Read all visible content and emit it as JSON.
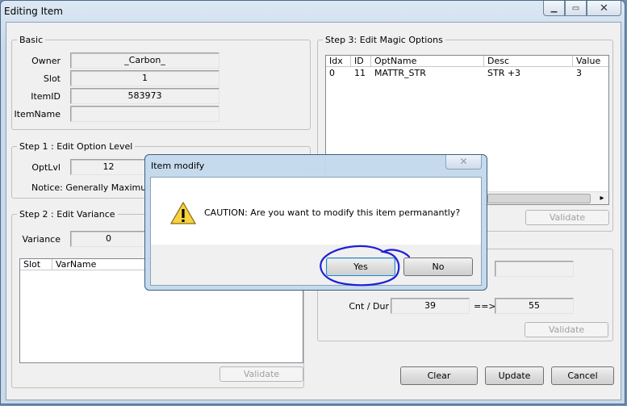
{
  "window": {
    "title": "Editing Item",
    "minimize_glyph": "▁",
    "maximize_glyph": "▭",
    "close_glyph": "✕"
  },
  "basic": {
    "legend": "Basic",
    "owner_label": "Owner",
    "owner_value": "_Carbon_",
    "slot_label": "Slot",
    "slot_value": "1",
    "itemid_label": "ItemID",
    "itemid_value": "583973",
    "itemname_label": "ItemName",
    "itemname_value": ""
  },
  "step1": {
    "legend": "Step 1 : Edit Option Level",
    "optlvl_label": "OptLvl",
    "optlvl_value": "12",
    "notice": "Notice: Generally Maximum Op"
  },
  "step2": {
    "legend": "Step 2 : Edit Variance",
    "variance_label": "Variance",
    "variance_value": "0",
    "columns": [
      "Slot",
      "VarName"
    ],
    "validate_label": "Validate"
  },
  "step3": {
    "legend": "Step 3: Edit Magic Options",
    "columns": [
      "Idx",
      "ID",
      "OptName",
      "Desc",
      "Value"
    ],
    "rows": [
      {
        "idx": "0",
        "id": "11",
        "optname": "MATTR_STR",
        "desc": "STR +3",
        "value": "3"
      }
    ],
    "scroll_right_glyph": "▸",
    "validate_label": "Validate"
  },
  "step4": {
    "cntdur_label": "Cnt / Dur",
    "cnt_value": "39",
    "arrow": "==>",
    "dur_value": "55",
    "extra_value": "",
    "validate_label": "Validate"
  },
  "actions": {
    "clear_label": "Clear",
    "update_label": "Update",
    "cancel_label": "Cancel"
  },
  "dialog": {
    "title": "Item modify",
    "close_glyph": "✕",
    "message": "CAUTION: Are you want to modify this item permanantly?",
    "yes_label": "Yes",
    "no_label": "No",
    "annotation_color": "#1f1fd6"
  }
}
